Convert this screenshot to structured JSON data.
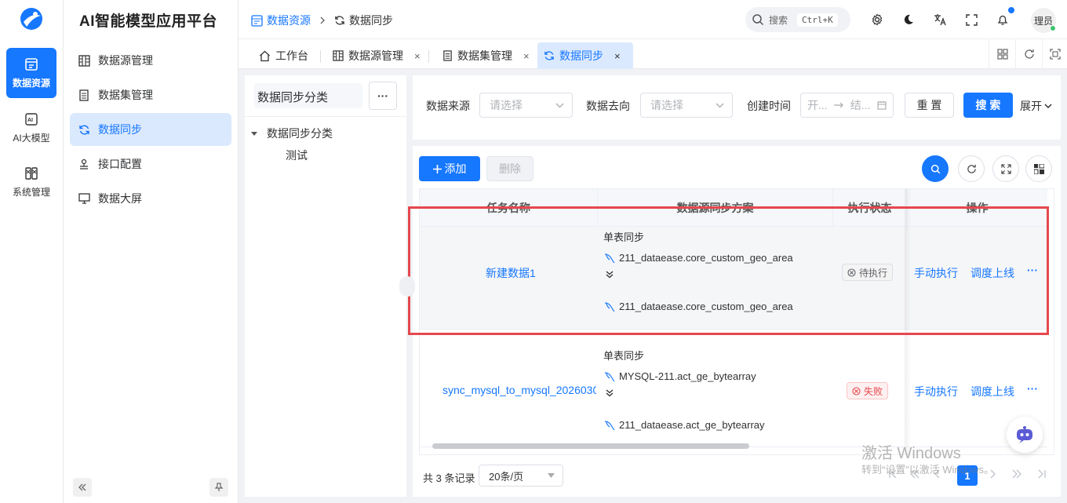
{
  "rail": {
    "items": [
      {
        "label": "数据资源",
        "icon": "datasource-icon"
      },
      {
        "label": "AI大模型",
        "icon": "ai-icon"
      },
      {
        "label": "系统管理",
        "icon": "system-icon"
      }
    ]
  },
  "brand": "AI智能模型应用平台",
  "menu": [
    {
      "label": "数据源管理",
      "icon": "database-icon"
    },
    {
      "label": "数据集管理",
      "icon": "list-icon"
    },
    {
      "label": "数据同步",
      "icon": "sync-icon"
    },
    {
      "label": "接口配置",
      "icon": "api-icon"
    },
    {
      "label": "数据大屏",
      "icon": "monitor-icon"
    }
  ],
  "breadcrumb": {
    "root": "数据资源",
    "current": "数据同步"
  },
  "search": {
    "placeholder": "搜索",
    "shortcut": "Ctrl+K"
  },
  "user": {
    "name": "理员"
  },
  "tabs": [
    {
      "label": "工作台"
    },
    {
      "label": "数据源管理"
    },
    {
      "label": "数据集管理"
    },
    {
      "label": "数据同步"
    }
  ],
  "close_glyph": "×",
  "classify": {
    "title": "数据同步分类",
    "more": "···",
    "tree_root": "数据同步分类",
    "tree_child": "测试"
  },
  "filter": {
    "source_label": "数据来源",
    "source_placeholder": "请选择",
    "target_label": "数据去向",
    "target_placeholder": "请选择",
    "created_label": "创建时间",
    "date_start": "开...",
    "date_end": "结...",
    "reset": "重 置",
    "search": "搜 索",
    "expand": "展开"
  },
  "toolbar": {
    "add": "添加",
    "delete": "删除"
  },
  "table": {
    "headers": [
      "任务名称",
      "数据源同步方案",
      "执行状态",
      "操作"
    ],
    "rows": [
      {
        "name": "新建数据1",
        "plan_type": "单表同步",
        "source": "211_dataease.core_custom_geo_area",
        "target": "211_dataease.core_custom_geo_area",
        "status": "待执行",
        "ops": [
          "手动执行",
          "调度上线",
          "···"
        ]
      },
      {
        "name": "sync_mysql_to_mysql_2026030",
        "plan_type": "单表同步",
        "source": "MYSQL-211.act_ge_bytearray",
        "target": "211_dataease.act_ge_bytearray",
        "status": "失败",
        "ops": [
          "手动执行",
          "调度上线",
          "···"
        ]
      }
    ]
  },
  "pager": {
    "total": "共 3 条记录",
    "page_size": "20条/页",
    "current_page": "1"
  },
  "watermark": {
    "line1": "激活 Windows",
    "line2": "转到“设置”以激活 Windows。"
  },
  "colors": {
    "primary": "#1677ff",
    "danger": "#e5484d",
    "active_bg": "#dbe9fe"
  }
}
